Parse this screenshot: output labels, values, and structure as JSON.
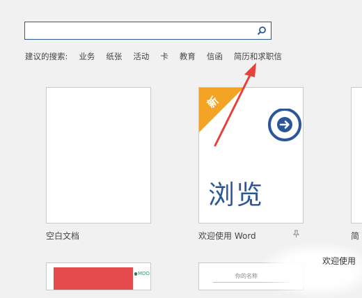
{
  "search": {
    "value": "",
    "placeholder": ""
  },
  "suggestions": {
    "label": "建议的搜索:",
    "keywords": [
      "业务",
      "纸张",
      "活动",
      "卡",
      "教育",
      "信函",
      "简历和求职信"
    ]
  },
  "templates": {
    "blank_caption": "空白文档",
    "browse_caption": "欢迎使用 Word",
    "new_badge": "新",
    "browse_text": "浏览",
    "next_caption_partial": "简",
    "moo_label": "MOO",
    "bottom_tile_text": "你的名称"
  },
  "overlay": {
    "watermark_text": "欢迎使用"
  },
  "colors": {
    "accent": "#2b579a",
    "badge": "#f3a424",
    "arrow": "#e8403a"
  }
}
